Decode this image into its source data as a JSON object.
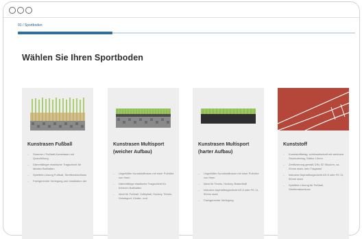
{
  "breadcrumb": {
    "step": "01 / Sportboden",
    "progress": 0.28
  },
  "heading": "Wählen Sie Ihren Sportboden",
  "cards": [
    {
      "title": "Kunstrasen Fußball",
      "features": [
        "Sommer-/ Fußball-Kunstrasen mit Quarzfüllung",
        "Dämmfähiger elastische Tragschicht für idealen Ballhalten",
        "Spielfeld-Lösung Fußball, Streifenabschluss",
        "Fachgerechte Verlegung und Installation der"
      ]
    },
    {
      "title": "Kunstrasen Multisport (weicher Aufbau)",
      "features": [
        "Ungefüllter Kunststoffrasen mit einer Polhöhe von 9mm",
        "Dämmfähige elastische Tragschicht für höheren Ballhalten",
        "Ideal für Fußball, Volleyball, Hockey, Tennis, Schulsport, Kinder- und"
      ]
    },
    {
      "title": "Kunstrasen Multisport (harter Aufbau)",
      "features": [
        "Ungefüllter Kunststoffrasen mit einer Polhöhe von 9mm",
        "Ideal für Tennis, Hockey, Basketball",
        "Inklusive Asphalttragschicht AS 8 oder FK 11, 50mm stark",
        "Fachgerechte Verlegung"
      ]
    },
    {
      "title": "Kunststoff",
      "features": [
        "Kunststoffbelag, schlüsselschaft mit weichem Strukturbelag, Stärke 13mm",
        "Zertifizierung gemäß DIN, 52 Stück/m, ca. 20mm stark, kein Tragsand",
        "Inklusive Asphalttragschicht AS 8 oder FK 11, 50mm stark",
        "Spielfeld-Lösung für Fußball, Streifenabschluss"
      ]
    }
  ]
}
